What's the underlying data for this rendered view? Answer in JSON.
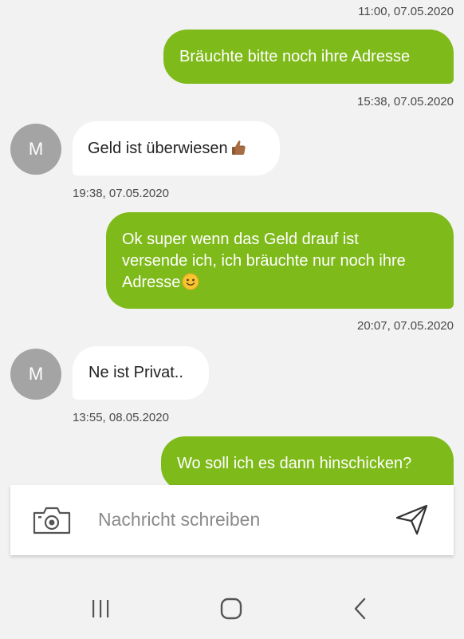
{
  "messages": [
    {
      "side": "out",
      "text": "Bräuchte bitte noch ihre Adresse",
      "time": "15:38, 07.05.2020"
    },
    {
      "side": "in",
      "avatar": "M",
      "text": "Geld ist überwiesen",
      "emoji": "thumbs-up-icon",
      "time": "19:38, 07.05.2020"
    },
    {
      "side": "out",
      "line1": "Ok super wenn das Geld drauf ist",
      "line2": "versende ich, ich bräuchte nur noch ihre",
      "line3": "Adresse",
      "emoji": "smiley-icon",
      "time": "20:07, 07.05.2020"
    },
    {
      "side": "in",
      "avatar": "M",
      "text": "Ne ist Privat..",
      "time": "13:55, 08.05.2020"
    },
    {
      "side": "out",
      "text": "Wo soll ich es dann hinschicken?"
    }
  ],
  "top_timestamp": "11:00, 07.05.2020",
  "composer": {
    "placeholder": "Nachricht schreiben",
    "left_icon": "camera-icon",
    "right_icon": "send-icon"
  },
  "navigation": [
    "recent-apps-icon",
    "home-icon",
    "back-icon"
  ],
  "colors": {
    "outgoing_bubble": "#7fba1b",
    "incoming_bubble": "#ffffff",
    "avatar": "#a4a4a4",
    "background": "#f2f2f2"
  }
}
